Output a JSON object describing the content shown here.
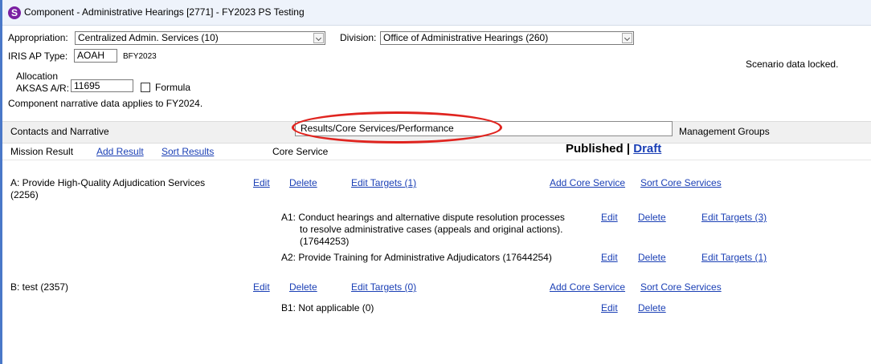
{
  "window": {
    "title": "Component - Administrative Hearings [2771] - FY2023 PS Testing",
    "icon": "app-logo-icon",
    "icon_glyph": "S"
  },
  "form": {
    "appropriation_label": "Appropriation:",
    "appropriation_value": "Centralized Admin. Services (10)",
    "division_label": "Division:",
    "division_value": "Office of Administrative Hearings (260)",
    "iris_label": "IRIS AP Type:",
    "iris_value": "AOAH",
    "bfy": "BFY2023",
    "allocation_label": "Allocation",
    "aksas_label": "AKSAS A/R:",
    "aksas_value": "11695",
    "formula_label": "Formula",
    "narrative_note": "Component narrative data applies to FY2024.",
    "locked_status": "Scenario data locked."
  },
  "tabs": {
    "contacts": "Contacts and Narrative",
    "results": "Results/Core Services/Performance",
    "management": "Management Groups"
  },
  "header": {
    "mission_result": "Mission Result",
    "add_result": "Add Result",
    "sort_results": "Sort Results",
    "core_service": "Core Service",
    "published": "Published",
    "separator": "|",
    "draft": "Draft"
  },
  "results": [
    {
      "title": "A: Provide High-Quality Adjudication Services",
      "id": "(2256)",
      "edit": "Edit",
      "delete": "Delete",
      "edit_targets": "Edit Targets (1)",
      "add_core": "Add Core Service",
      "sort_core": "Sort Core Services",
      "services": [
        {
          "lines": [
            "A1: Conduct hearings and alternative dispute resolution processes",
            "to resolve administrative cases (appeals and original actions).",
            "(17644253)"
          ],
          "edit": "Edit",
          "delete": "Delete",
          "edit_targets": "Edit Targets (3)"
        },
        {
          "lines": [
            "A2: Provide Training for Administrative Adjudicators (17644254)"
          ],
          "edit": "Edit",
          "delete": "Delete",
          "edit_targets": "Edit Targets (1)"
        }
      ]
    },
    {
      "title": "B: test (2357)",
      "edit": "Edit",
      "delete": "Delete",
      "edit_targets": "Edit Targets (0)",
      "add_core": "Add Core Service",
      "sort_core": "Sort Core Services",
      "services": [
        {
          "lines": [
            "B1: Not applicable (0)"
          ],
          "edit": "Edit",
          "delete": "Delete"
        }
      ]
    }
  ],
  "colors": {
    "link": "#1a3fb5",
    "highlight": "#e0241f",
    "titlebar": "#eef3fb"
  }
}
